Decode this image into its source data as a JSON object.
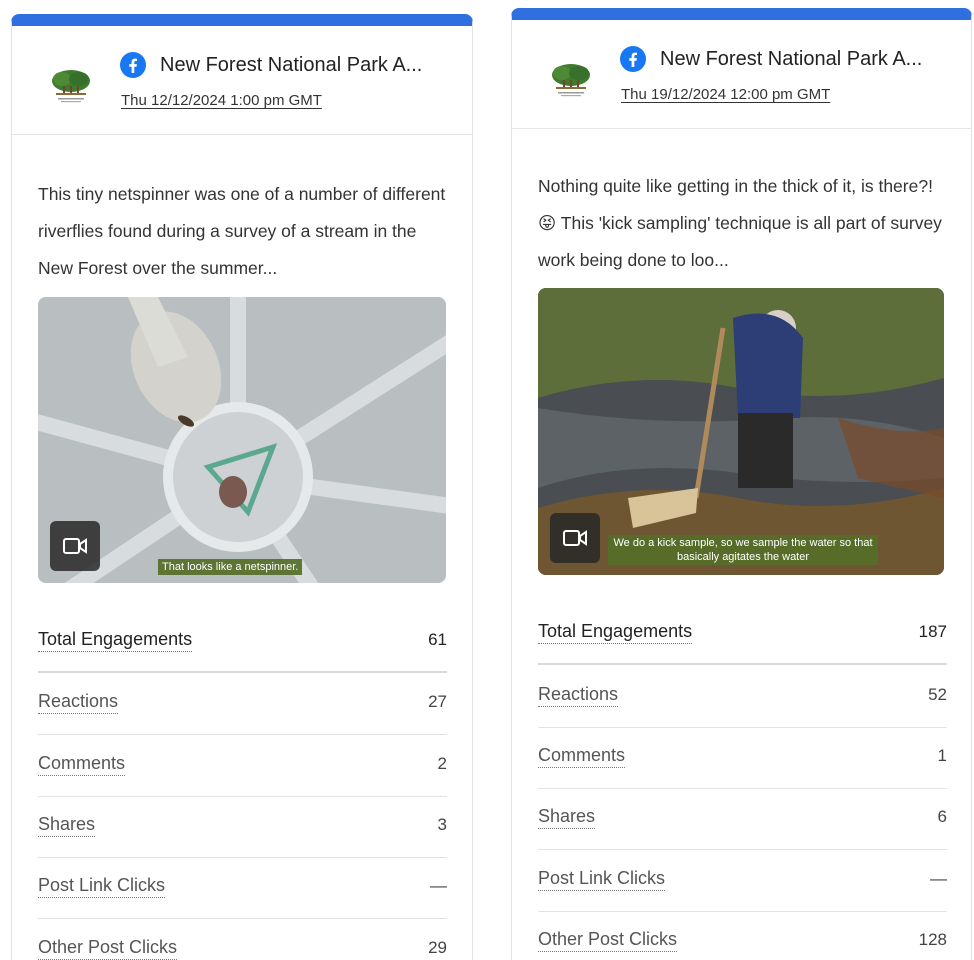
{
  "posts": [
    {
      "account_name": "New Forest National Park A...",
      "date": "Thu 12/12/2024 1:00 pm GMT",
      "text": "This tiny netspinner was one of a number of different riverflies found during a survey of a stream in the New Forest over the summer...",
      "caption": "That looks like a netspinner.",
      "metrics": [
        {
          "label": "Total Engagements",
          "value": "61"
        },
        {
          "label": "Reactions",
          "value": "27"
        },
        {
          "label": "Comments",
          "value": "2"
        },
        {
          "label": "Shares",
          "value": "3"
        },
        {
          "label": "Post Link Clicks",
          "value": "—"
        },
        {
          "label": "Other Post Clicks",
          "value": "29"
        }
      ]
    },
    {
      "account_name": "New Forest National Park A...",
      "date": "Thu 19/12/2024 12:00 pm GMT",
      "text": "Nothing quite like getting in the thick of it, is there?! 😝 This 'kick sampling' technique is all part of survey work being done to loo...",
      "caption": "We do a kick sample, so we sample the water so that basically agitates the water",
      "metrics": [
        {
          "label": "Total Engagements",
          "value": "187"
        },
        {
          "label": "Reactions",
          "value": "52"
        },
        {
          "label": "Comments",
          "value": "1"
        },
        {
          "label": "Shares",
          "value": "6"
        },
        {
          "label": "Post Link Clicks",
          "value": "—"
        },
        {
          "label": "Other Post Clicks",
          "value": "128"
        }
      ]
    }
  ],
  "colors": {
    "accent": "#2f6fe0",
    "facebook": "#1877f2"
  }
}
